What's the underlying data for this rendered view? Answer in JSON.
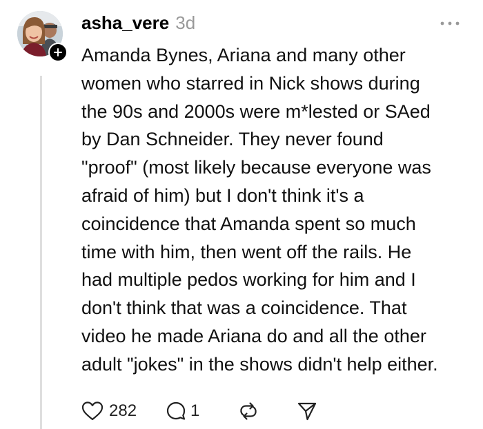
{
  "post": {
    "author": {
      "username": "asha_vere",
      "avatar_icon": "profile-photo",
      "follow_icon": "plus-icon"
    },
    "timestamp": "3d",
    "menu_icon": "more-horizontal-icon",
    "body_lines": [
      "Amanda Bynes, Ariana and many other",
      "women who starred in Nick shows during",
      "the 90s and 2000s were m*lested or SAed",
      "by Dan Schneider. They never found",
      "\"proof\" (most likely because everyone was",
      "afraid of him) but I don't think it's a",
      "coincidence that Amanda spent so much",
      "time with him, then went off the rails. He",
      "had multiple pedos working for him and I",
      "don't think that was a coincidence. That",
      "video he made Ariana do and all the other",
      "adult \"jokes\" in the shows didn't help either."
    ],
    "actions": {
      "like": {
        "icon": "heart-icon",
        "count": "282"
      },
      "reply": {
        "icon": "comment-icon",
        "count": "1"
      },
      "repost": {
        "icon": "repost-icon"
      },
      "share": {
        "icon": "send-icon"
      }
    }
  },
  "colors": {
    "text": "#111111",
    "muted": "#999999",
    "thread_line": "#dedede",
    "background": "#ffffff"
  }
}
